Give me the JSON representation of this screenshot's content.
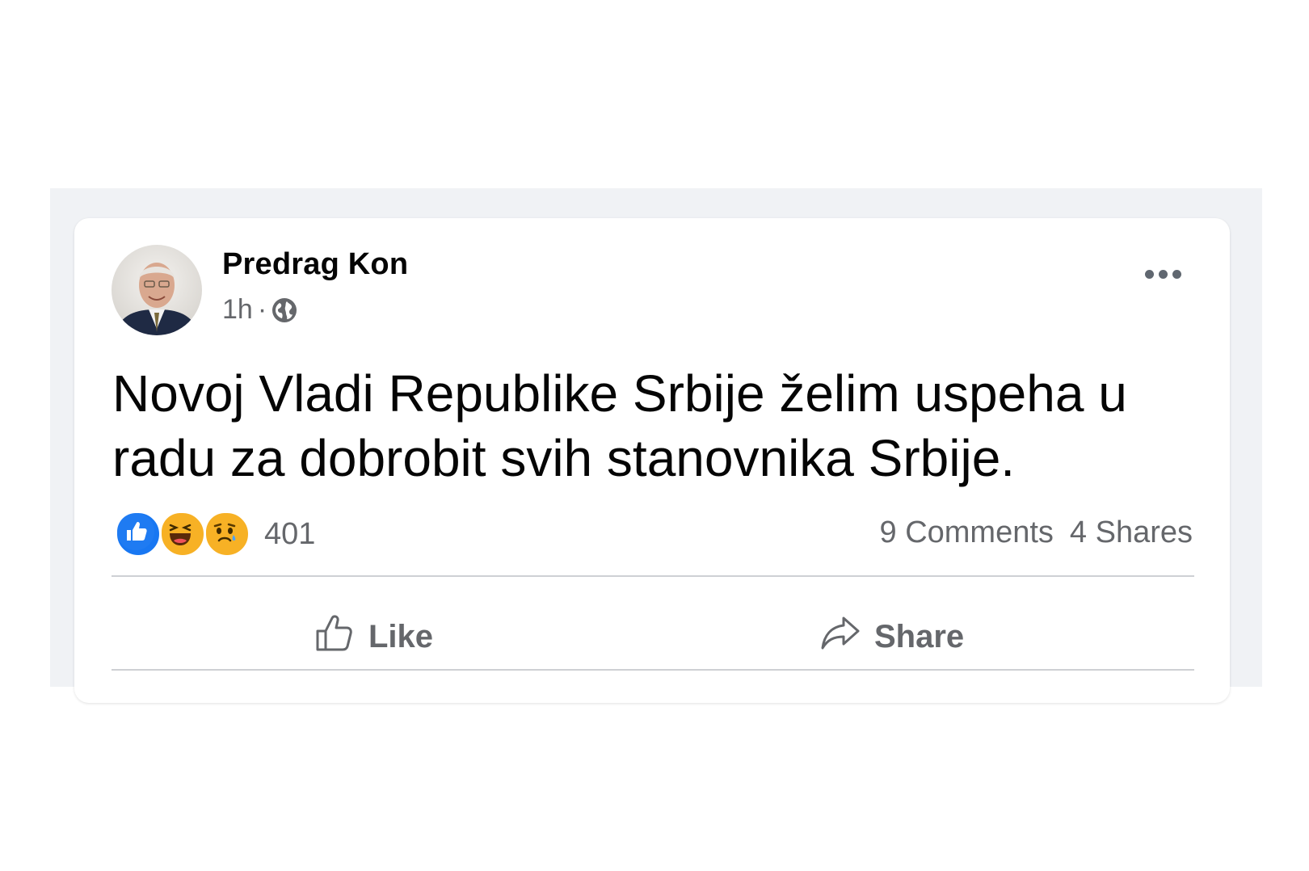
{
  "post": {
    "author": "Predrag Kon",
    "time": "1h",
    "separator": "·",
    "privacy_icon": "globe-icon",
    "more_icon": "more-options-icon",
    "text": "Novoj Vladi Republike Srbije želim uspeha u radu za dobrobit svih stanovnika Srbije.",
    "reactions": {
      "types": [
        "like",
        "haha",
        "sad"
      ],
      "count": "401"
    },
    "comments_label": "9 Comments",
    "shares_label": "4 Shares",
    "actions": {
      "like_label": "Like",
      "share_label": "Share"
    }
  },
  "colors": {
    "feed_background": "#f0f2f5",
    "like_blue": "#1877f2",
    "emoji_yellow": "#f7b125",
    "muted_text": "#65676b"
  }
}
